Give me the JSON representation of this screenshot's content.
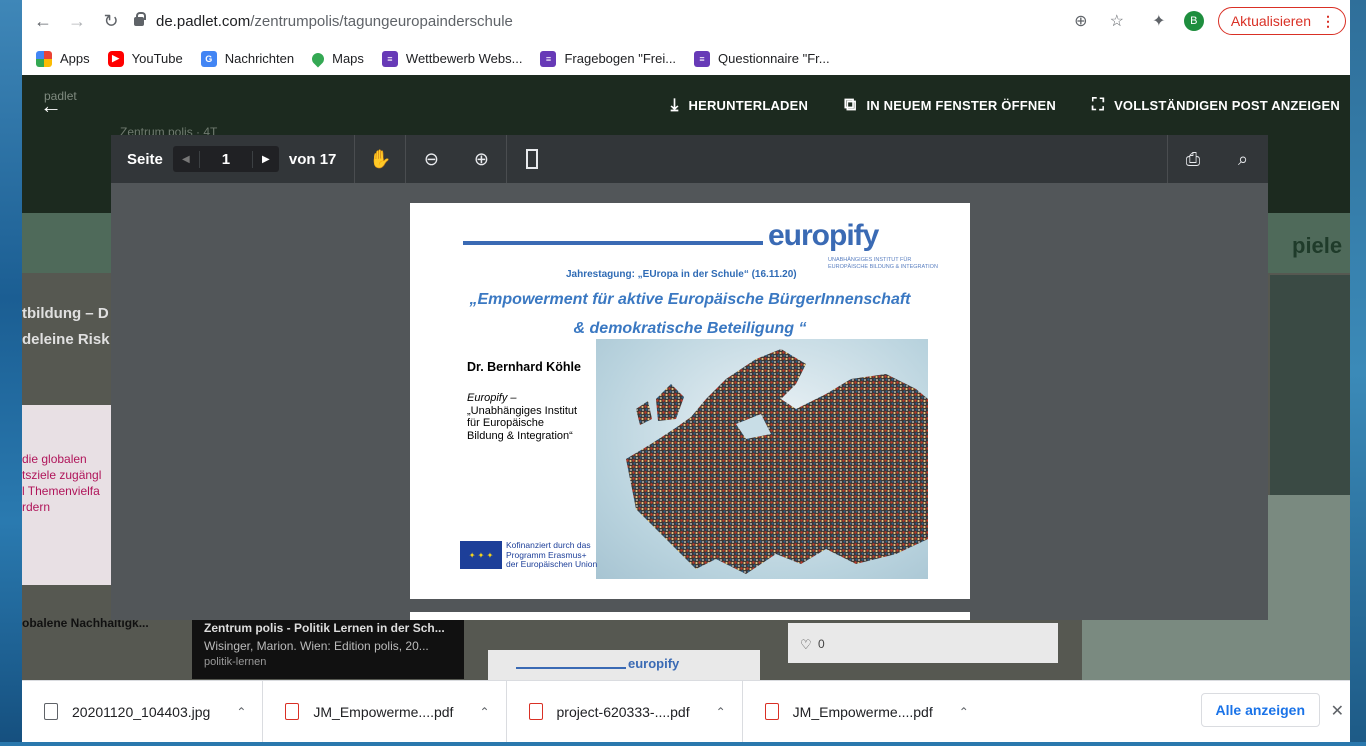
{
  "browser": {
    "url_host": "de.padlet.com",
    "url_path": "/zentrumpolis/tagungeuropainderschule",
    "profile_initial": "B",
    "update_label": "Aktualisieren",
    "bookmarks": [
      {
        "label": "Apps",
        "icon": "apps-grid-icon"
      },
      {
        "label": "YouTube",
        "icon": "youtube-icon"
      },
      {
        "label": "Nachrichten",
        "icon": "news-icon"
      },
      {
        "label": "Maps",
        "icon": "maps-pin-icon"
      },
      {
        "label": "Wettbewerb Webs...",
        "icon": "forms-icon"
      },
      {
        "label": "Fragebogen \"Frei...",
        "icon": "forms-icon"
      },
      {
        "label": "Questionnaire \"Fr...",
        "icon": "forms-icon"
      }
    ]
  },
  "background_page": {
    "header_left": "padlet",
    "profile_line": "Zentrum polis · 4T",
    "left_texts": [
      "tbildung – D",
      "deleine Risk",
      "die globalen",
      "tsziele zugängl",
      "l Themenvielfa",
      "rdern",
      "obalene Nachhaltigk..."
    ],
    "card_title": "Zentrum polis - Politik Lernen in der Sch...",
    "card_sub": "Wisinger, Marion. Wien: Edition polis, 20...",
    "card_tag": "politik-lernen",
    "likes": "0",
    "right_heading": "piele",
    "card_logo": "europify"
  },
  "overlay": {
    "download_label": "HERUNTERLADEN",
    "new_window_label": "IN NEUEM FENSTER ÖFFNEN",
    "full_post_label": "VOLLSTÄNDIGEN POST ANZEIGEN"
  },
  "viewer": {
    "page_label": "Seite",
    "current_page": "1",
    "of_label": "von 17"
  },
  "pdf": {
    "logo": "europify",
    "logo_sub": "UNABHÄNGIGES INSTITUT FÜR EUROPÄISCHE BILDUNG & INTEGRATION",
    "conference": "Jahrestagung: „EUropa in der Schule“ (16.11.20)",
    "title_line1": "„Empowerment für aktive Europäische BürgerInnenschaft",
    "title_line2": "& demokratische Beteiligung “",
    "author": "Dr. Bernhard Köhle",
    "institute_lines": [
      "Europify –",
      "„Unabhängiges Institut",
      "für Europäische",
      "Bildung & Integration“"
    ],
    "eu_lines": [
      "Kofinanziert durch das",
      "Programm Erasmus+",
      "der Europäischen Union"
    ]
  },
  "downloads": {
    "items": [
      {
        "name": "20201120_104403.jpg",
        "type": "image"
      },
      {
        "name": "JM_Empowerme....pdf",
        "type": "pdf"
      },
      {
        "name": "project-620333-....pdf",
        "type": "pdf"
      },
      {
        "name": "JM_Empowerme....pdf",
        "type": "pdf"
      }
    ],
    "show_all": "Alle anzeigen"
  },
  "colors": {
    "brand_blue": "#3a6ab4",
    "update_red": "#d93025",
    "link_blue": "#1a73e8"
  }
}
